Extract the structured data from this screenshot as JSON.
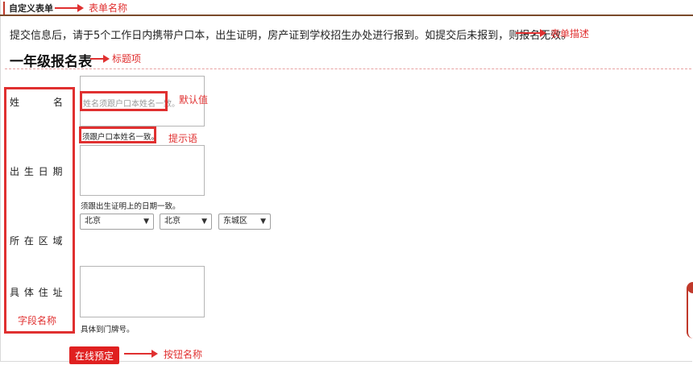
{
  "form": {
    "name_tag": "自定义表单",
    "description": "提交信息后，请于5个工作日内携带户口本，出生证明，房产证到学校招生办处进行报到。如提交后未报到，则报名无效。",
    "title": "一年级报名表",
    "fields": {
      "name": {
        "label": "姓　　名",
        "placeholder": "姓名须跟户口本姓名一致。",
        "hint": "须跟户口本姓名一致。"
      },
      "birth": {
        "label": "出 生 日 期",
        "hint": "须跟出生证明上的日期一致。"
      },
      "region": {
        "label": "所 在 区 域",
        "province": "北京",
        "city": "北京",
        "district": "东城区"
      },
      "address": {
        "label": "具 体 住 址",
        "hint": "具体到门牌号。"
      }
    },
    "submit_label": "在线预定"
  },
  "annotations": {
    "form_name": "表单名称",
    "form_desc": "表单描述",
    "title_item": "标题项",
    "default_value": "默认值",
    "hint": "提示语",
    "field_name": "字段名称",
    "button_name": "按钮名称"
  },
  "colors": {
    "annotation": "#e03030",
    "button": "#e02020",
    "topbar": "#7a4a2a"
  }
}
